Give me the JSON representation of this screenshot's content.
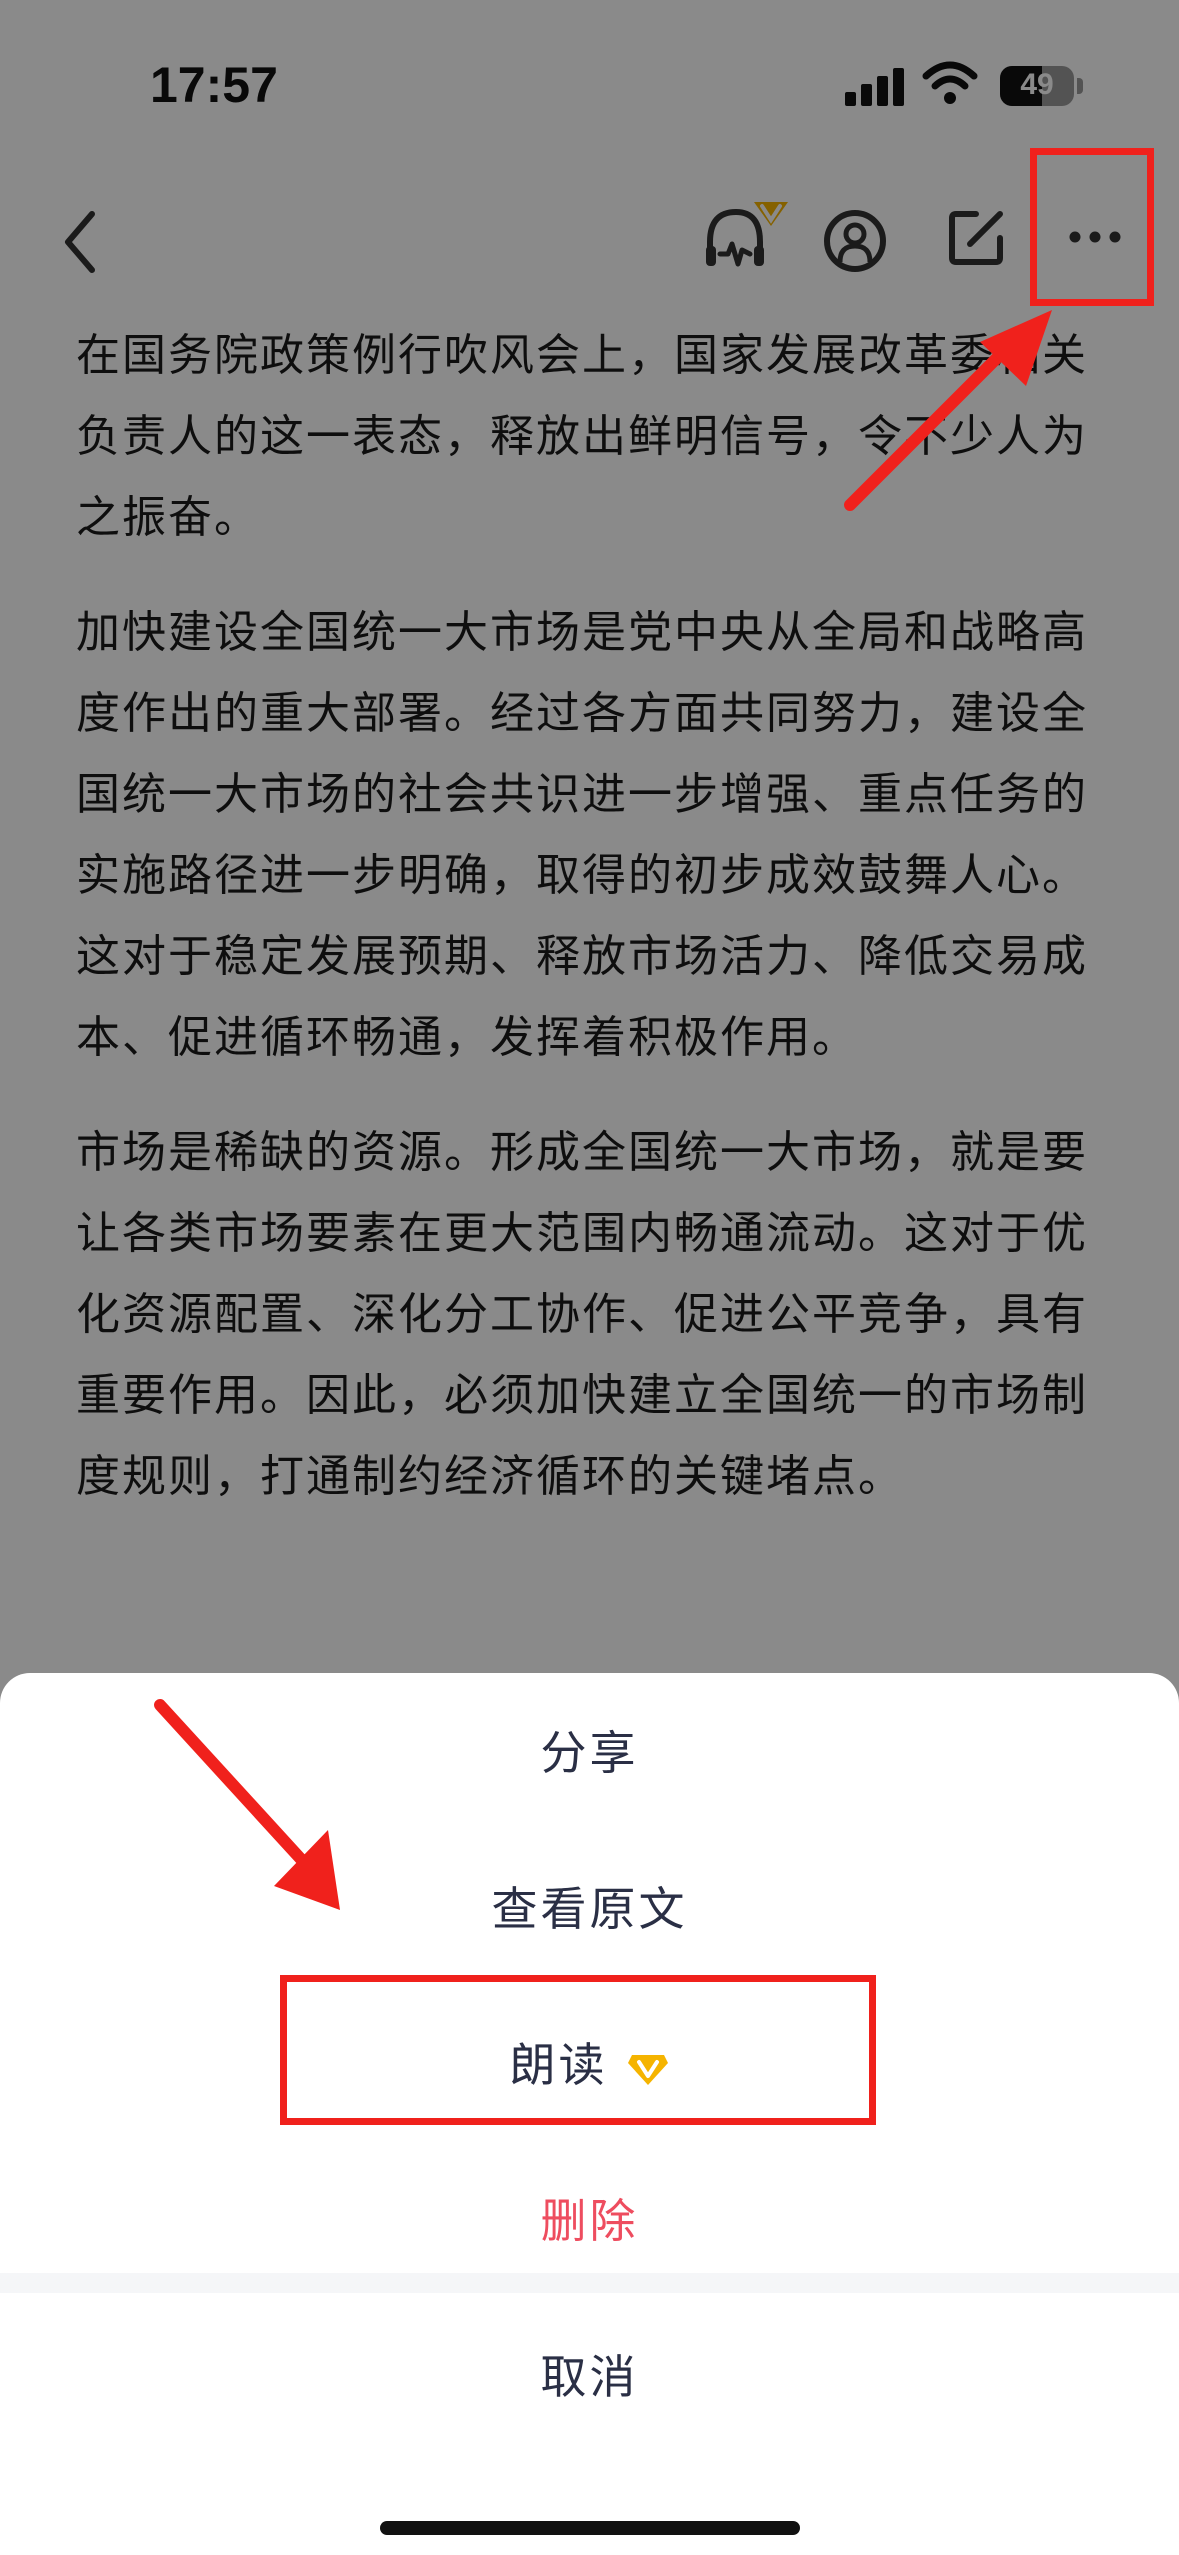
{
  "status_bar": {
    "time": "17:57",
    "battery_level": "49"
  },
  "nav": {
    "back_icon": "chevron-left-icon",
    "listen_icon": "headphones-icon",
    "profile_icon": "user-circle-icon",
    "edit_icon": "edit-icon",
    "more_icon": "more-horizontal-icon"
  },
  "article": {
    "paragraphs": [
      "在国务院政策例行吹风会上，国家发展改革委相关负责人的这一表态，释放出鲜明信号，令不少人为之振奋。",
      "加快建设全国统一大市场是党中央从全局和战略高度作出的重大部署。经过各方面共同努力，建设全国统一大市场的社会共识进一步增强、重点任务的实施路径进一步明确，取得的初步成效鼓舞人心。这对于稳定发展预期、释放市场活力、降低交易成本、促进循环畅通，发挥着积极作用。",
      "市场是稀缺的资源。形成全国统一大市场，就是要让各类市场要素在更大范围内畅通流动。这对于优化资源配置、深化分工协作、促进公平竞争，具有重要作用。因此，必须加快建立全国统一的市场制度规则，打通制约经济循环的关键堵点。"
    ]
  },
  "action_sheet": {
    "share": "分享",
    "view_original": "查看原文",
    "read_aloud": "朗读",
    "delete": "删除",
    "cancel": "取消"
  },
  "colors": {
    "annotation_red": "#f0211c",
    "danger": "#ee4d5f",
    "vip_gold": "#f5b400"
  }
}
